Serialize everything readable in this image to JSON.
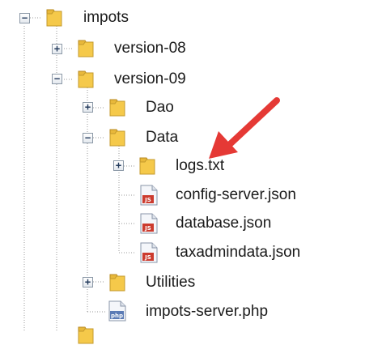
{
  "tree": {
    "nodes": [
      {
        "label": "impots",
        "icon": "folder-icon",
        "toggle": "−"
      },
      {
        "label": "version-08",
        "icon": "folder-icon",
        "toggle": "+"
      },
      {
        "label": "version-09",
        "icon": "folder-icon",
        "toggle": "−"
      },
      {
        "label": "Dao",
        "icon": "folder-icon",
        "toggle": "+"
      },
      {
        "label": "Data",
        "icon": "folder-icon",
        "toggle": "−"
      },
      {
        "label": "logs.txt",
        "icon": "folder-icon",
        "toggle": "+"
      },
      {
        "label": "config-server.json",
        "icon": "js-file-icon",
        "badge": "JS"
      },
      {
        "label": "database.json",
        "icon": "js-file-icon",
        "badge": "JS"
      },
      {
        "label": "taxadmindata.json",
        "icon": "js-file-icon",
        "badge": "JS"
      },
      {
        "label": "Utilities",
        "icon": "folder-icon",
        "toggle": "+"
      },
      {
        "label": "impots-server.php",
        "icon": "php-file-icon",
        "badge": "php"
      }
    ]
  },
  "colors": {
    "folder_fill": "#f5c94a",
    "folder_edge": "#c49a2c",
    "arrow": "#e53935",
    "toggle_border": "#8c99a7",
    "js_badge": "#cc3b2e",
    "php_badge": "#5b7bb5"
  }
}
